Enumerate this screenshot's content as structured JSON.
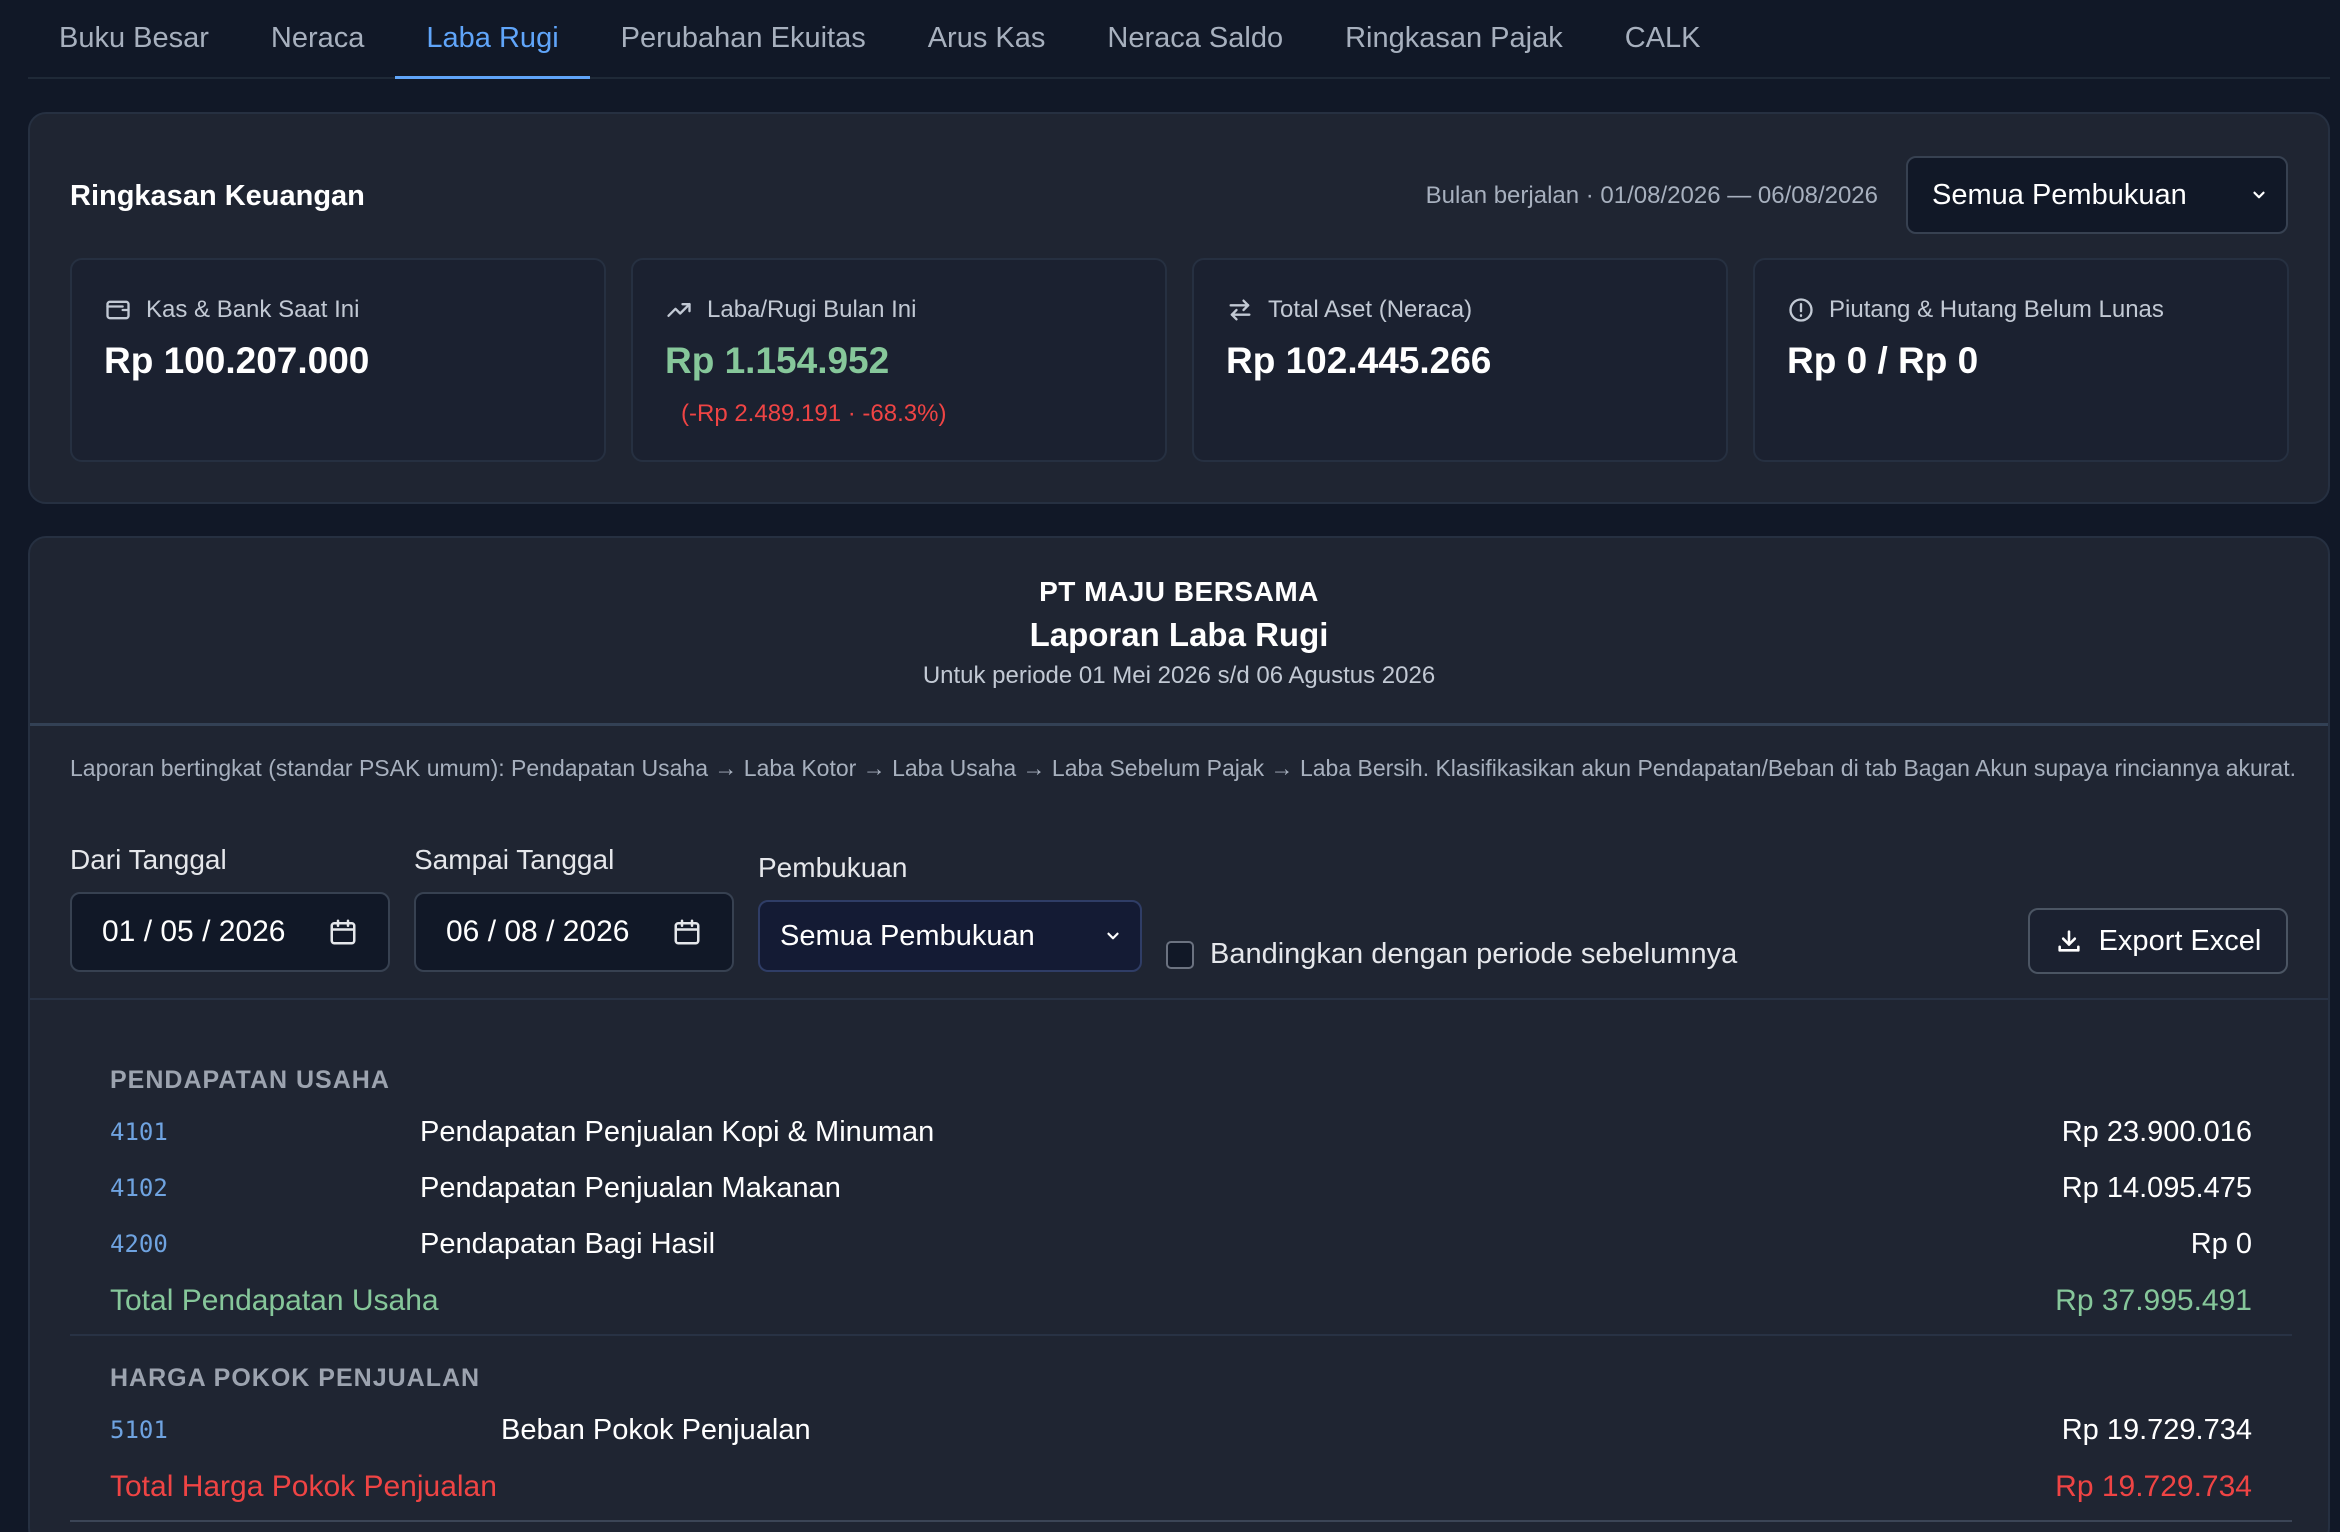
{
  "tabs": [
    {
      "label": "Buku Besar",
      "active": false
    },
    {
      "label": "Neraca",
      "active": false
    },
    {
      "label": "Laba Rugi",
      "active": true
    },
    {
      "label": "Perubahan Ekuitas",
      "active": false
    },
    {
      "label": "Arus Kas",
      "active": false
    },
    {
      "label": "Neraca Saldo",
      "active": false
    },
    {
      "label": "Ringkasan Pajak",
      "active": false
    },
    {
      "label": "CALK",
      "active": false
    }
  ],
  "summary": {
    "title": "Ringkasan Keuangan",
    "period": "Bulan berjalan · 01/08/2026 — 06/08/2026",
    "ledger_select": "Semua Pembukuan",
    "metrics": [
      {
        "icon": "wallet-icon",
        "label": "Kas & Bank Saat Ini",
        "value": "Rp 100.207.000"
      },
      {
        "icon": "trending-up-icon",
        "label": "Laba/Rugi Bulan Ini",
        "value": "Rp 1.154.952",
        "change": "(-Rp 2.489.191 · -68.3%)"
      },
      {
        "icon": "arrows-exchange-icon",
        "label": "Total Aset (Neraca)",
        "value": "Rp 102.445.266"
      },
      {
        "icon": "alert-circle-icon",
        "label": "Piutang & Hutang Belum Lunas",
        "value": "Rp 0 / Rp 0"
      }
    ]
  },
  "report": {
    "company": "PT MAJU BERSAMA",
    "title": "Laporan Laba Rugi",
    "period": "Untuk periode 01 Mei 2026 s/d 06 Agustus 2026",
    "note": "Laporan bertingkat (standar PSAK umum): Pendapatan Usaha → Laba Kotor → Laba Usaha → Laba Sebelum Pajak → Laba Bersih. Klasifikasikan akun Pendapatan/Beban di tab Bagan Akun supaya rinciannya akurat.",
    "filters": {
      "from_label": "Dari Tanggal",
      "from_value": "01 / 05 / 2026",
      "to_label": "Sampai Tanggal",
      "to_value": "06 / 08 / 2026",
      "ledger_label": "Pembukuan",
      "ledger_value": "Semua Pembukuan",
      "compare_label": "Bandingkan dengan periode sebelumnya",
      "export_label": "Export Excel"
    },
    "sections": [
      {
        "heading": "PENDAPATAN USAHA",
        "accounts": [
          {
            "code": "4101",
            "name": "Pendapatan Penjualan Kopi & Minuman",
            "amount": "Rp 23.900.016"
          },
          {
            "code": "4102",
            "name": "Pendapatan Penjualan Makanan",
            "amount": "Rp 14.095.475"
          },
          {
            "code": "4200",
            "name": "Pendapatan Bagi Hasil",
            "amount": "Rp 0"
          }
        ],
        "total_label": "Total Pendapatan Usaha",
        "total_amount": "Rp 37.995.491"
      },
      {
        "heading": "HARGA POKOK PENJUALAN",
        "accounts": [
          {
            "code": "5101",
            "name": "Beban Pokok Penjualan",
            "amount": "Rp 19.729.734"
          }
        ],
        "total_label": "Total Harga Pokok Penjualan",
        "total_amount": "Rp 19.729.734"
      }
    ]
  },
  "colors": {
    "accent": "#60a5fa",
    "positive": "#86c79a",
    "negative": "#ef4444",
    "background": "#111827",
    "card": "#1f2532"
  }
}
